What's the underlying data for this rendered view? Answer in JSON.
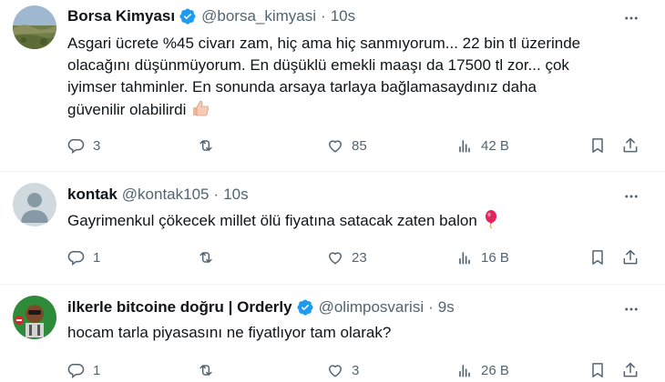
{
  "tweets": [
    {
      "name": "Borsa Kimyası",
      "handle": "@borsa_kimyasi",
      "separator": "·",
      "time": "10s",
      "lines": [
        "Asgari ücrete %45 civarı zam, hiç ama hiç sanmıyorum... 22 bin tl üzerinde",
        "olacağını düşünmüyorum. En düşüklü emekli maaşı da 17500 tl zor... çok",
        "iyimser tahminler. En sonunda arsaya tarlaya bağlamasaydınız daha",
        "güvenilir olabilirdi"
      ],
      "emoji": "thumbs-up-icon",
      "replies": "3",
      "retweets": "",
      "likes": "85",
      "views": "42 B"
    },
    {
      "name": "kontak",
      "handle": "@kontak105",
      "separator": "·",
      "time": "10s",
      "lines": [
        "Gayrimenkul çökecek millet ölü fiyatına satacak zaten balon"
      ],
      "emoji": "balloon-icon",
      "replies": "1",
      "retweets": "",
      "likes": "23",
      "views": "16 B"
    },
    {
      "name": "ilkerle bitcoine doğru | Orderly",
      "handle": "@olimposvarisi",
      "separator": "·",
      "time": "9s",
      "lines": [
        "hocam tarla piyasasını ne fiyatlıyor tam olarak?"
      ],
      "replies": "1",
      "retweets": "",
      "likes": "3",
      "views": "26 B"
    }
  ],
  "colors": {
    "text": "#0f1419",
    "secondary": "#536471",
    "verified": "#1d9bf0",
    "divider": "#eff3f4"
  }
}
